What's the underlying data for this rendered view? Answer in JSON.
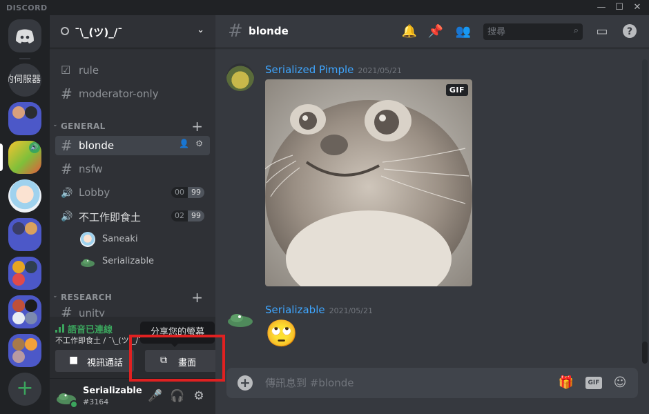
{
  "window": {
    "brand": "DISCORD",
    "min": "—",
    "max": "☐",
    "close": "✕"
  },
  "rail": {
    "server_text": "的伺服器"
  },
  "guild": {
    "name": "¯\\_(ツ)_/¯"
  },
  "channels_top": [
    {
      "icon": "☑",
      "label": "rule"
    },
    {
      "icon": "#",
      "label": "moderator-only"
    }
  ],
  "categories": {
    "general": "GENERAL",
    "research": "RESEARCH"
  },
  "general_channels": [
    {
      "icon": "#",
      "label": "blonde"
    },
    {
      "icon": "#",
      "label": "nsfw"
    },
    {
      "icon": "🔊",
      "label": "Lobby",
      "users": "00",
      "limit": "99"
    },
    {
      "icon": "🔊",
      "label": "不工作即食土",
      "users": "02",
      "limit": "99"
    }
  ],
  "voice_users": [
    {
      "name": "Saneaki"
    },
    {
      "name": "Serializable"
    }
  ],
  "research_channels": [
    {
      "label": "unity"
    }
  ],
  "voice_panel": {
    "status": "語音已連線",
    "channel": "不工作即食土 / ¯\\_(ツ)_/¯",
    "video_label": "視訊通話",
    "screen_label": "畫面",
    "tooltip": "分享您的螢幕"
  },
  "user": {
    "name": "Serializable",
    "tag": "#3164"
  },
  "chat": {
    "channel": "blonde",
    "search_placeholder": "搜尋",
    "messages": [
      {
        "author": "Serialized Pimple",
        "time": "2021/05/21",
        "gif_badge": "GIF"
      },
      {
        "author": "Serializable",
        "time": "2021/05/21",
        "emoji": "🙄"
      }
    ],
    "composer_placeholder": "傳訊息到 #blonde",
    "gif_label": "GIF"
  },
  "colors": {
    "accent": "#5865f2",
    "green": "#3ba55d",
    "link": "#3fa6ff",
    "highlight": "#e02121"
  }
}
